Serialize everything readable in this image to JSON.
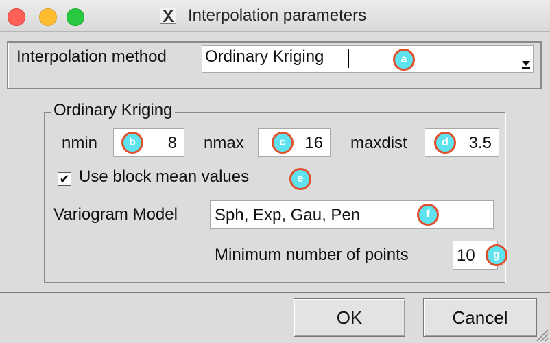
{
  "window": {
    "title": "Interpolation parameters",
    "app_icon": "x11-icon"
  },
  "method": {
    "label": "Interpolation method",
    "value": "Ordinary Kriging",
    "badge": "a"
  },
  "group": {
    "title": "Ordinary Kriging",
    "nmin": {
      "label": "nmin",
      "value": "8",
      "badge": "b"
    },
    "nmax": {
      "label": "nmax",
      "value": "16",
      "badge": "c"
    },
    "maxdist": {
      "label": "maxdist",
      "value": "3.5",
      "badge": "d"
    },
    "block_mean": {
      "label": "Use block mean values",
      "checked": true,
      "badge": "e"
    },
    "variogram": {
      "label": "Variogram Model",
      "value": "Sph, Exp, Gau, Pen",
      "badge": "f"
    },
    "min_points": {
      "label": "Minimum number of points",
      "value": "10",
      "badge": "g"
    }
  },
  "buttons": {
    "ok": "OK",
    "cancel": "Cancel"
  },
  "colors": {
    "badge_fill": "#5ee2ee",
    "badge_border": "#e0502e",
    "close": "#fe5f57",
    "minimize": "#febc2e",
    "maximize": "#28c840"
  }
}
